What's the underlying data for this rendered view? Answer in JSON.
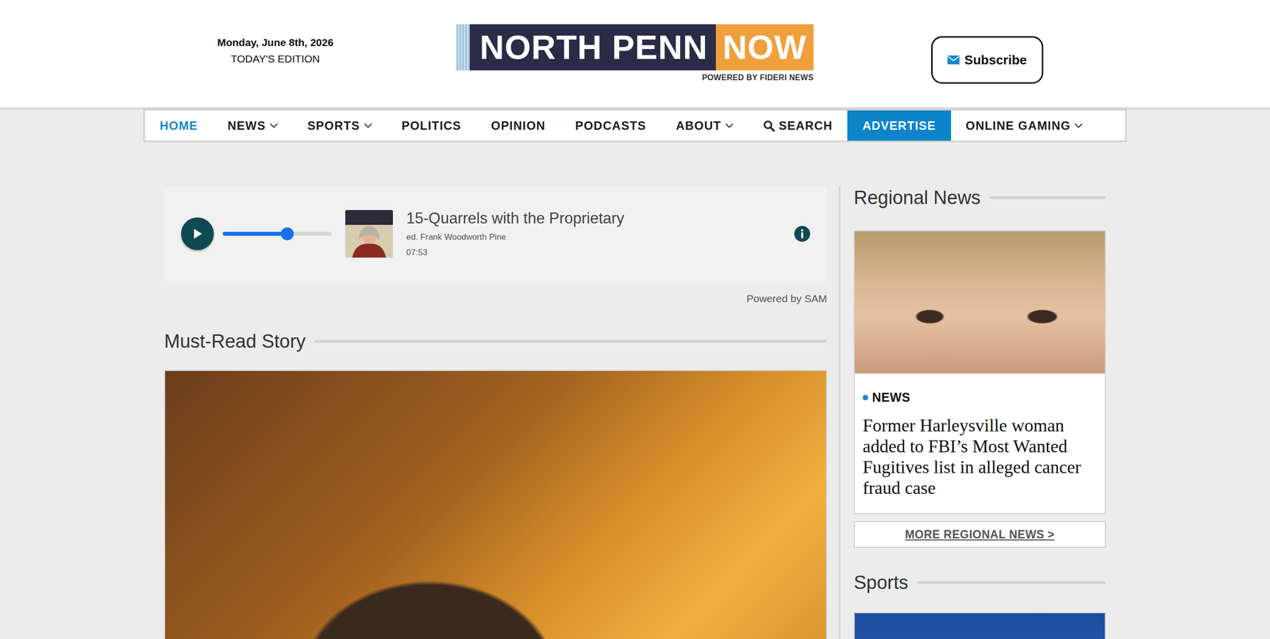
{
  "header": {
    "date": "Monday, June 8th, 2026",
    "edition": "TODAY'S EDITION",
    "logo": {
      "name": "NORTH PENN",
      "accent": "NOW",
      "tagline": "POWERED BY FIDERI NEWS"
    },
    "subscribe": "Subscribe"
  },
  "nav": [
    {
      "label": "HOME",
      "kind": "link",
      "selected": true,
      "has_menu": false
    },
    {
      "label": "NEWS",
      "kind": "link",
      "selected": false,
      "has_menu": true
    },
    {
      "label": "SPORTS",
      "kind": "link",
      "selected": false,
      "has_menu": true
    },
    {
      "label": "POLITICS",
      "kind": "link",
      "selected": false,
      "has_menu": false
    },
    {
      "label": "OPINION",
      "kind": "link",
      "selected": false,
      "has_menu": false
    },
    {
      "label": "PODCASTS",
      "kind": "link",
      "selected": false,
      "has_menu": false
    },
    {
      "label": "ABOUT",
      "kind": "link",
      "selected": false,
      "has_menu": true
    },
    {
      "label": "SEARCH",
      "kind": "search",
      "selected": false,
      "has_menu": false
    },
    {
      "label": "ADVERTISE",
      "kind": "promo",
      "selected": false,
      "has_menu": false
    },
    {
      "label": "ONLINE GAMING",
      "kind": "link",
      "selected": false,
      "has_menu": true
    }
  ],
  "player": {
    "playing": false,
    "level": 0.59,
    "title": "15-Quarrels with the Proprietary",
    "author": "ed. Frank Woodworth Pine",
    "duration": "07:53",
    "credit": "Powered by SAM"
  },
  "must_read": {
    "heading": "Must-Read Story"
  },
  "regional": {
    "heading": "Regional News",
    "category": "NEWS",
    "headline": "Former Harleysville woman added to FBI’s Most Wanted Fugitives list in alleged cancer fraud case",
    "more": "MORE REGIONAL NEWS >"
  },
  "sports": {
    "heading": "Sports"
  }
}
